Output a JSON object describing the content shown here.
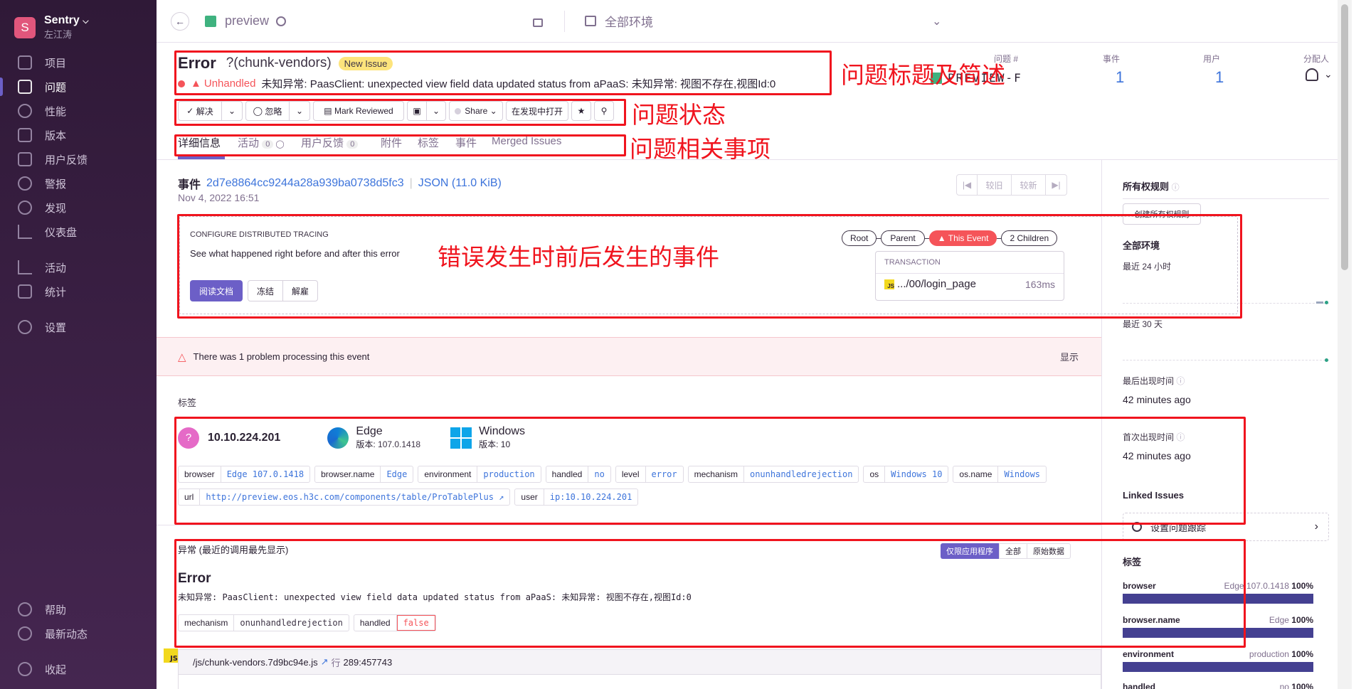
{
  "org": {
    "avatar_letter": "S",
    "name": "Sentry",
    "user": "左江涛"
  },
  "nav": {
    "items": [
      "项目",
      "问题",
      "性能",
      "版本",
      "用户反馈",
      "警报",
      "发现",
      "仪表盘",
      "活动",
      "统计",
      "设置"
    ],
    "bottom": [
      "帮助",
      "最新动态",
      "收起"
    ]
  },
  "topbar": {
    "project": "preview",
    "env": "全部环境"
  },
  "issue": {
    "type": "Error",
    "culprit": "?(chunk-vendors)",
    "badge": "New Issue",
    "unhandled": "Unhandled",
    "message": "未知异常: PaasClient: unexpected view field data updated status from aPaaS: 未知异常: 视图不存在,视图Id:0",
    "id_label": "问题 #",
    "id_value": "PREVIEW-F",
    "events_label": "事件",
    "events_value": "1",
    "users_label": "用户",
    "users_value": "1",
    "assignee_label": "分配人"
  },
  "actions": {
    "resolve": "解决",
    "ignore": "忽略",
    "reviewed": "Mark Reviewed",
    "share": "Share",
    "open_discover": "在发现中打开"
  },
  "tabs": {
    "details": "详细信息",
    "activity": "活动",
    "activity_count": "0",
    "feedback": "用户反馈",
    "feedback_count": "0",
    "attachments": "附件",
    "tags": "标签",
    "events": "事件",
    "merged": "Merged Issues"
  },
  "annotations": {
    "title": "问题标题及简述",
    "status": "问题状态",
    "related": "问题相关事项",
    "tracing": "错误发生时前后发生的事件"
  },
  "event": {
    "label": "事件",
    "id": "2d7e8864cc9244a28a939ba0738d5fc3",
    "json": "JSON (11.0 KiB)",
    "date": "Nov 4, 2022 16:51",
    "older": "较旧",
    "newer": "较新"
  },
  "tracing": {
    "heading": "CONFIGURE DISTRIBUTED TRACING",
    "desc": "See what happened right before and after this error",
    "read_docs": "阅读文档",
    "snooze": "冻结",
    "dismiss": "解雇",
    "root": "Root",
    "parent": "Parent",
    "this_event": "This Event",
    "children": "2 Children",
    "txn_heading": "TRANSACTION",
    "txn_name": ".../00/login_page",
    "txn_time": "163ms"
  },
  "problem": {
    "text": "There was 1 problem processing this event",
    "show": "显示"
  },
  "tags_section": {
    "title": "标签",
    "ip": "10.10.224.201",
    "browser_name": "Edge",
    "browser_version_label": "版本:",
    "browser_version": "107.0.1418",
    "os_name": "Windows",
    "os_version_label": "版本:",
    "os_version": "10",
    "tags": [
      {
        "k": "browser",
        "v": "Edge 107.0.1418"
      },
      {
        "k": "browser.name",
        "v": "Edge"
      },
      {
        "k": "environment",
        "v": "production"
      },
      {
        "k": "handled",
        "v": "no"
      },
      {
        "k": "level",
        "v": "error"
      },
      {
        "k": "mechanism",
        "v": "onunhandledrejection"
      },
      {
        "k": "os",
        "v": "Windows 10"
      },
      {
        "k": "os.name",
        "v": "Windows"
      },
      {
        "k": "url",
        "v": "http://preview.eos.h3c.com/components/table/ProTablePlus"
      },
      {
        "k": "user",
        "v": "ip:10.10.224.201"
      }
    ]
  },
  "exception": {
    "title": "异常 (最近的调用最先显示)",
    "app_only": "仅限应用程序",
    "all": "全部",
    "raw": "原始数据",
    "type": "Error",
    "message": "未知异常: PaasClient: unexpected view field data updated status from aPaaS: 未知异常: 视图不存在,视图Id:0",
    "mechanism_label": "mechanism",
    "mechanism_value": "onunhandledrejection",
    "handled_label": "handled",
    "handled_value": "false",
    "frame_file": "/js/chunk-vendors.7d9bc94e.js",
    "frame_line_label": "行",
    "frame_line": "289:457743"
  },
  "sidebar_right": {
    "ownership": "所有权规则",
    "create_ownership": "创建所有权规则",
    "all_env": "全部环境",
    "last24": "最近 24 小时",
    "last30": "最近 30 天",
    "last_seen": "最后出现时间",
    "last_seen_value": "42 minutes ago",
    "first_seen": "首次出现时间",
    "first_seen_value": "42 minutes ago",
    "linked": "Linked Issues",
    "setup_tracking": "设置问题跟踪",
    "tags": "标签",
    "tag_bars": [
      {
        "k": "browser",
        "v": "Edge 107.0.1418",
        "pct": "100%"
      },
      {
        "k": "browser.name",
        "v": "Edge",
        "pct": "100%"
      },
      {
        "k": "environment",
        "v": "production",
        "pct": "100%"
      },
      {
        "k": "handled",
        "v": "no",
        "pct": "100%"
      }
    ]
  }
}
